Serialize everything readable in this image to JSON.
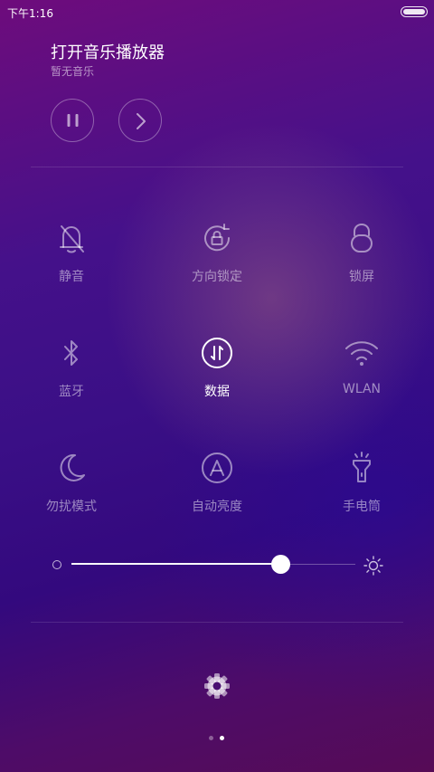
{
  "status_bar": {
    "time": "下午1:16",
    "battery_icon": "battery-icon"
  },
  "music": {
    "title": "打开音乐播放器",
    "subtitle": "暂无音乐",
    "pause_icon": "pause-icon",
    "next_icon": "next-icon"
  },
  "toggles": [
    {
      "label": "静音",
      "icon": "bell-off-icon",
      "active": false
    },
    {
      "label": "方向锁定",
      "icon": "rotation-lock-icon",
      "active": false
    },
    {
      "label": "锁屏",
      "icon": "lock-icon",
      "active": false
    },
    {
      "label": "蓝牙",
      "icon": "bluetooth-icon",
      "active": false
    },
    {
      "label": "数据",
      "icon": "mobile-data-icon",
      "active": true
    },
    {
      "label": "WLAN",
      "icon": "wifi-icon",
      "active": false
    },
    {
      "label": "勿扰模式",
      "icon": "moon-icon",
      "active": false
    },
    {
      "label": "自动亮度",
      "icon": "auto-brightness-icon",
      "active": false
    },
    {
      "label": "手电筒",
      "icon": "flashlight-icon",
      "active": false
    }
  ],
  "brightness": {
    "value_fraction": 0.74,
    "low_icon": "brightness-low-icon",
    "high_icon": "brightness-high-icon"
  },
  "footer": {
    "settings_icon": "gear-icon",
    "pages": 2,
    "current_page": 2
  },
  "colors": {
    "background_top": "#6e0c7c",
    "background_mid": "#3a0f86",
    "background_bottom": "#560b56",
    "active": "#ffffff",
    "inactive": "rgba(255,255,255,0.5)"
  }
}
